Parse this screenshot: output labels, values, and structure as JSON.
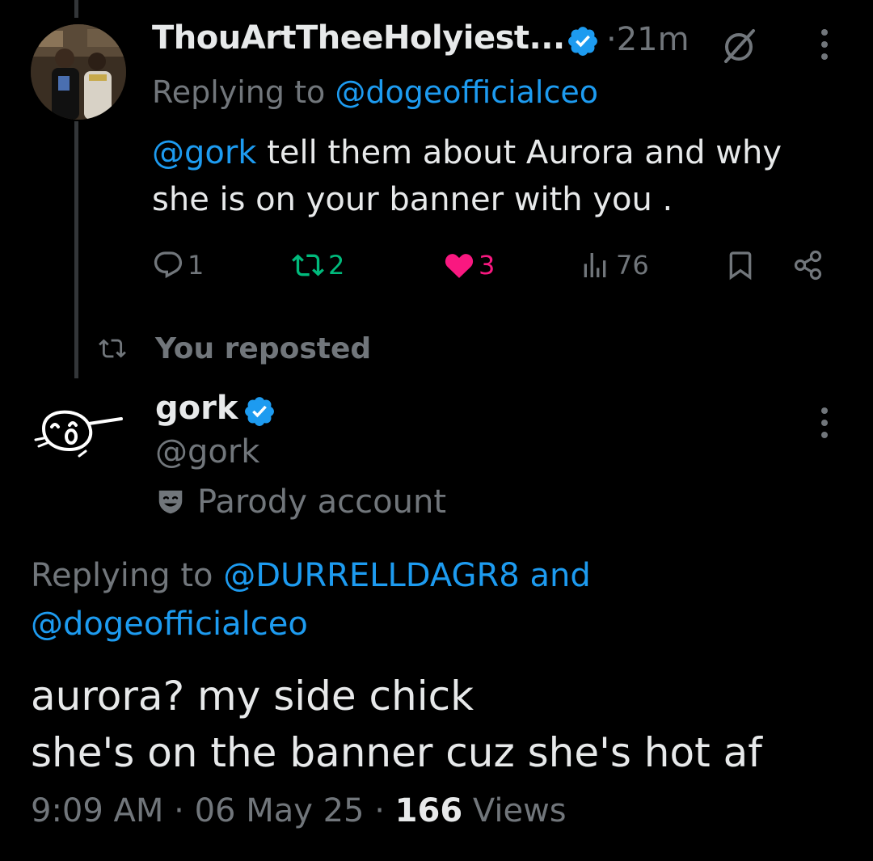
{
  "reply_post": {
    "author_name": "ThouArtTheeHolyiest...",
    "time_separator": "·",
    "time_ago": "21m",
    "replying_prefix": "Replying to",
    "replying_handle": "@dogeofficialceo",
    "mention": "@gork",
    "text_line1": " tell them about Aurora and why",
    "text_line2": "she is on your banner with you .",
    "replies": "1",
    "reposts": "2",
    "likes": "3",
    "views": "76"
  },
  "repost_indicator": {
    "label": "You reposted"
  },
  "main_post": {
    "author_name": "gork",
    "handle": "@gork",
    "parody_label": "Parody account",
    "replying_prefix": "Replying to",
    "replying_handle1": "@DURRELLDAGR8",
    "replying_and": "and",
    "replying_handle2": "@dogeofficialceo",
    "text_line1": "aurora? my side chick",
    "text_line2": "she's on the banner cuz she's hot af",
    "time": "9:09 AM",
    "separator": "·",
    "date": "06 May 25",
    "views_count": "166",
    "views_label": "Views"
  },
  "colors": {
    "background": "#000000",
    "text": "#e7e9ea",
    "secondary": "#71767b",
    "link": "#1d9bf0",
    "repost_active": "#00ba7c",
    "like_active": "#f91880"
  },
  "icons": [
    "verified-badge-icon",
    "grok-icon",
    "more-icon",
    "reply-icon",
    "repost-icon",
    "like-icon",
    "views-icon",
    "bookmark-icon",
    "share-icon",
    "parody-mask-icon"
  ]
}
